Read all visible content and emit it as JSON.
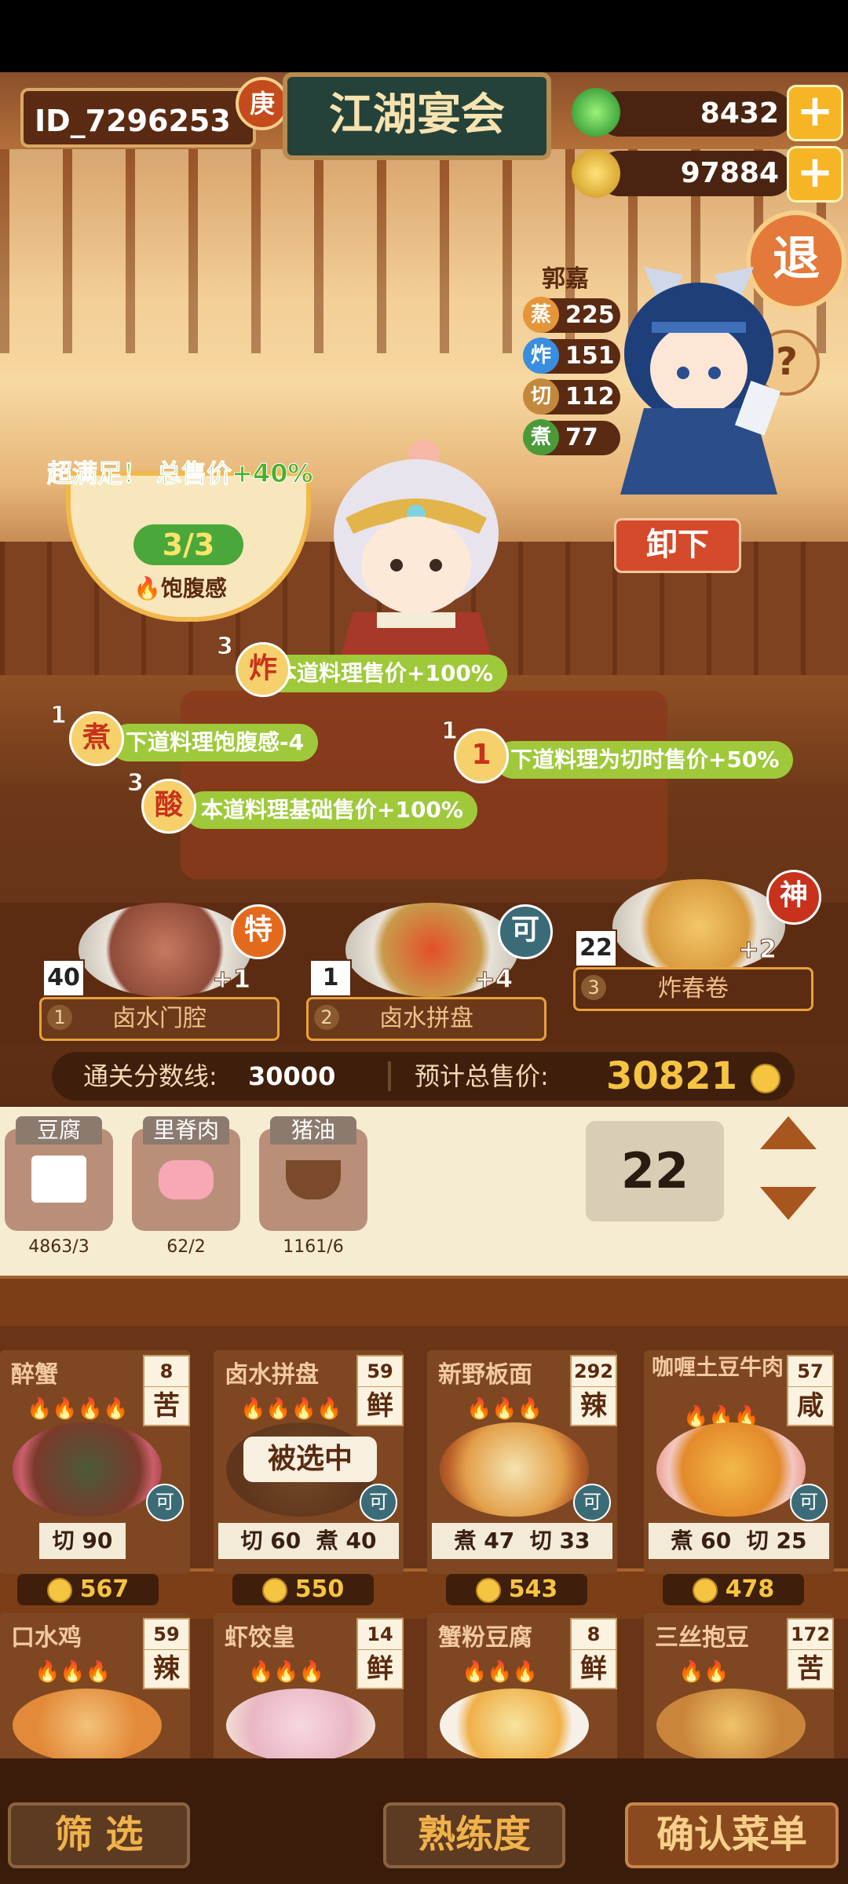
{
  "header": {
    "player_id": "ID_7296253",
    "id_badge": "庚",
    "title": "江湖宴会",
    "jade_amount": "8432",
    "coin_amount": "97884",
    "plus_label": "+",
    "exit_label": "退",
    "help_label": "?"
  },
  "chef": {
    "name": "郭嘉",
    "skills": [
      {
        "label": "蒸",
        "value": "225",
        "color": "#e5963a"
      },
      {
        "label": "炸",
        "value": "151",
        "color": "#3a8ee0"
      },
      {
        "label": "切",
        "value": "112",
        "color": "#c2893d"
      },
      {
        "label": "煮",
        "value": "77",
        "color": "#4a9a3a"
      }
    ],
    "unload_label": "卸下"
  },
  "satisfaction": {
    "text": "超满足！ 总售价+40%",
    "count": "3/3",
    "label": "饱腹感"
  },
  "effects": [
    {
      "num": "3",
      "icon": "炸",
      "text": "本道料理售价+100%"
    },
    {
      "num": "1",
      "icon": "煮",
      "text": "下道料理饱腹感-4"
    },
    {
      "num": "1",
      "icon": "1",
      "text": "下道料理为切时售价+50%"
    },
    {
      "num": "3",
      "icon": "酸",
      "text": "本道料理基础售价+100%"
    }
  ],
  "served_dishes": [
    {
      "slot": "1",
      "qty": "40",
      "name": "卤水门腔",
      "bonus": "+1",
      "grade": "特",
      "grade_color": "#e36a1c"
    },
    {
      "slot": "2",
      "qty": "1",
      "name": "卤水拼盘",
      "bonus": "+4",
      "grade": "可",
      "grade_color": "#3b6b76"
    },
    {
      "slot": "3",
      "qty": "22",
      "name": "炸春卷",
      "bonus": "+2",
      "grade": "神",
      "grade_color": "#c8321c"
    }
  ],
  "score": {
    "pass_label": "通关分数线:",
    "pass_value": "30000",
    "total_label": "预计总售价:",
    "total_value": "30821"
  },
  "ingredients": [
    {
      "name": "豆腐",
      "qty": "4863/3"
    },
    {
      "name": "里脊肉",
      "qty": "62/2"
    },
    {
      "name": "猪油",
      "qty": "1161/6"
    }
  ],
  "selected_count": "22",
  "recipes": [
    {
      "name": "醉蟹",
      "count": "8",
      "taste": "苦",
      "flames": "🔥🔥🔥🔥",
      "skills": [
        [
          "切",
          "90"
        ]
      ],
      "price": "567",
      "grade": "可"
    },
    {
      "name": "卤水拼盘",
      "count": "59",
      "taste": "鲜",
      "flames": "🔥🔥🔥🔥",
      "skills": [
        [
          "切",
          "60"
        ],
        [
          "煮",
          "40"
        ]
      ],
      "price": "550",
      "grade": "可",
      "selected_label": "被选中"
    },
    {
      "name": "新野板面",
      "count": "292",
      "taste": "辣",
      "flames": "🔥🔥🔥",
      "skills": [
        [
          "煮",
          "47"
        ],
        [
          "切",
          "33"
        ]
      ],
      "price": "543",
      "grade": "可"
    },
    {
      "name": "咖喱土豆牛肉",
      "count": "57",
      "taste": "咸",
      "flames": "🔥🔥🔥",
      "skills": [
        [
          "煮",
          "60"
        ],
        [
          "切",
          "25"
        ]
      ],
      "price": "478",
      "grade": "可"
    },
    {
      "name": "口水鸡",
      "count": "59",
      "taste": "辣",
      "flames": "🔥🔥🔥"
    },
    {
      "name": "虾饺皇",
      "count": "14",
      "taste": "鲜",
      "flames": "🔥🔥🔥"
    },
    {
      "name": "蟹粉豆腐",
      "count": "8",
      "taste": "鲜",
      "flames": "🔥🔥🔥"
    },
    {
      "name": "三丝抱豆",
      "count": "172",
      "taste": "苦",
      "flames": "🔥🔥"
    }
  ],
  "bottom": {
    "filter_label": "筛 选",
    "mastery_label": "熟练度",
    "confirm_label": "确认菜单"
  }
}
